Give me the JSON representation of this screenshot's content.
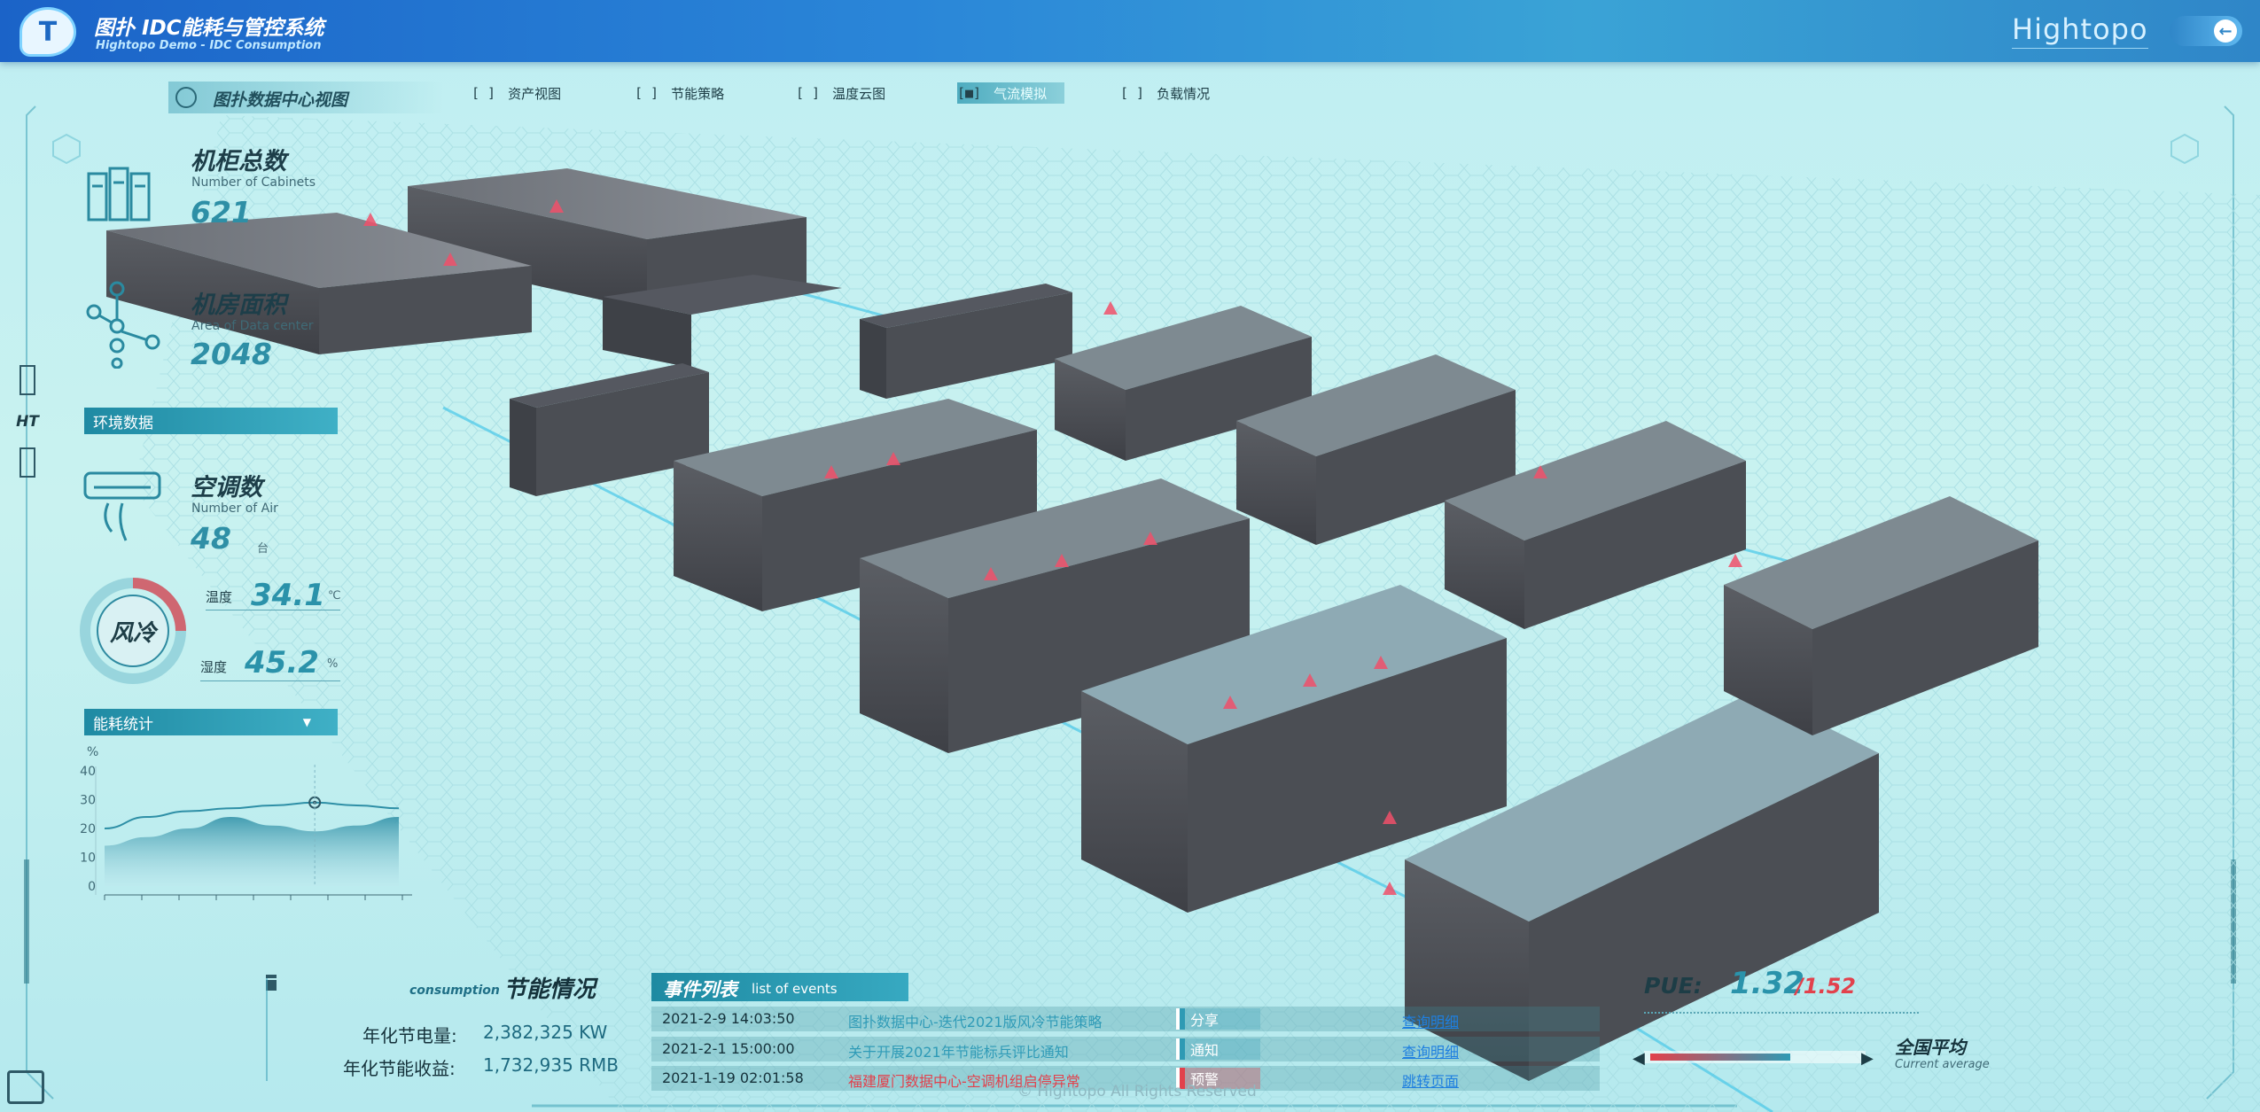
{
  "header": {
    "title": "图扑 IDC能耗与管控系统",
    "subtitle": "Hightopo Demo - IDC Consumption",
    "brand": "Hightopo",
    "logo_letter": "T",
    "back_icon": "arrow-left-icon"
  },
  "nav": {
    "title": "图扑数据中心视图",
    "tabs": [
      {
        "label": "资产视图",
        "active": false
      },
      {
        "label": "节能策略",
        "active": false
      },
      {
        "label": "温度云图",
        "active": false
      },
      {
        "label": "气流模拟",
        "active": true
      },
      {
        "label": "负载情况",
        "active": false
      }
    ]
  },
  "stats": {
    "cabinets": {
      "title": "机柜总数",
      "en": "Number of Cabinets",
      "value": "621"
    },
    "area": {
      "title": "机房面积",
      "en": "Area of Data center",
      "value": "2048"
    }
  },
  "side_badge": "HT",
  "environment": {
    "section_title": "环境数据",
    "air": {
      "title": "空调数",
      "en": "Number of Air",
      "value": "48",
      "unit": "台"
    },
    "mode": "风冷",
    "temperature": {
      "label": "温度",
      "value": "34.1",
      "unit": "℃"
    },
    "humidity": {
      "label": "湿度",
      "value": "45.2",
      "unit": "%"
    }
  },
  "energy": {
    "section_title": "能耗统计",
    "dropdown_icon": "caret-down-icon"
  },
  "chart_data": {
    "type": "area",
    "ylabel": "%",
    "ylim": [
      0,
      40
    ],
    "yticks": [
      "40",
      "30",
      "20",
      "10",
      "0"
    ],
    "series": [
      {
        "values": [
          20,
          24,
          26,
          27,
          28,
          29,
          28,
          27
        ]
      },
      {
        "values": [
          14,
          17,
          20,
          24,
          21,
          19,
          21,
          24
        ]
      }
    ]
  },
  "savings": {
    "title": "节能情况",
    "subtitle": "consumption",
    "annual_power_label": "年化节电量:",
    "annual_power_value": "2,382,325 KW",
    "annual_income_label": "年化节能收益:",
    "annual_income_value": "1,732,935 RMB"
  },
  "events": {
    "title": "事件列表",
    "subtitle": "list of events",
    "rows": [
      {
        "time": "2021-2-9 14:03:50",
        "title": "图扑数据中心-迭代2021版风冷节能策略",
        "tag": "分享",
        "link": "查询明细",
        "alert": false
      },
      {
        "time": "2021-2-1 15:00:00",
        "title": "关于开展2021年节能标兵评比通知",
        "tag": "通知",
        "link": "查询明细",
        "alert": false
      },
      {
        "time": "2021-1-19 02:01:58",
        "title": "福建厦门数据中心-空调机组启停异常",
        "tag": "预警",
        "link": "跳转页面",
        "alert": true
      }
    ]
  },
  "pue": {
    "label": "PUE:",
    "value": "1.32",
    "national": "/1.52",
    "avg_label": "全国平均",
    "avg_en": "Current average",
    "fill_fraction": 0.67
  },
  "copyright": "© Hightopo All Rights Reserved"
}
